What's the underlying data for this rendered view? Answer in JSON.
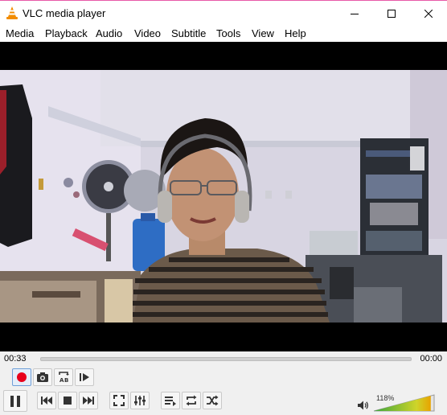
{
  "window": {
    "title": "VLC media player",
    "icon": "vlc-cone-icon",
    "controls": [
      "minimize-icon",
      "maximize-icon",
      "close-icon"
    ]
  },
  "menu": {
    "items": [
      "Media",
      "Playback",
      "Audio",
      "Video",
      "Subtitle",
      "Tools",
      "View",
      "Help"
    ]
  },
  "player": {
    "elapsed": "00:33",
    "total": "00:00",
    "progress": 0
  },
  "advanced_controls": [
    "record-icon",
    "snapshot-icon",
    "loop-ab-icon",
    "frame-step-icon"
  ],
  "main_controls": [
    "pause-icon",
    "previous-icon",
    "stop-icon",
    "next-icon",
    "fullscreen-icon",
    "extended-settings-icon",
    "playlist-icon",
    "loop-icon",
    "shuffle-icon"
  ],
  "volume": {
    "label": "118%",
    "level": 1.18,
    "icon": "speaker-icon"
  },
  "colors": {
    "record": "#e8001c",
    "volume_low": "#3aa63a",
    "volume_high": "#e8a300",
    "title_accent": "#e85aa8"
  }
}
